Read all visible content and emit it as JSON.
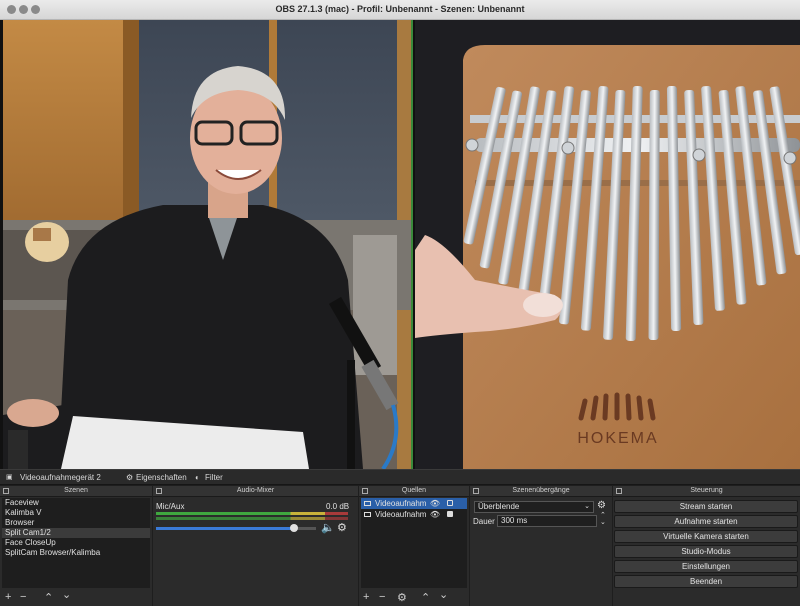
{
  "window": {
    "title": "OBS 27.1.3 (mac) - Profil: Unbenannt - Szenen: Unbenannt"
  },
  "preview": {
    "logo_text": "HOKEMA"
  },
  "sourcebar": {
    "source_name": "Videoaufnahmegerät 2",
    "properties_label": "Eigenschaften",
    "filter_label": "Filter"
  },
  "scenes": {
    "title": "Szenen",
    "items": [
      "Faceview",
      "Kalimba V",
      "Browser",
      "Split Cam1/2",
      "Face CloseUp",
      "SplitCam Browser/Kalimba"
    ],
    "selected_index": 3
  },
  "audio": {
    "title": "Audio-Mixer",
    "channel": "Mic/Aux",
    "level": "0.0 dB",
    "volume_fraction": 0.86
  },
  "sources": {
    "title": "Quellen",
    "items": [
      "Videoaufnahm",
      "Videoaufnahm"
    ]
  },
  "transitions": {
    "title": "Szenenübergänge",
    "selected": "Überblende",
    "duration_label": "Dauer",
    "duration_value": "300 ms"
  },
  "controls": {
    "title": "Steuerung",
    "stream": "Stream starten",
    "record": "Aufnahme starten",
    "virtual_cam": "Virtuelle Kamera starten",
    "studio": "Studio-Modus",
    "settings": "Einstellungen",
    "exit": "Beenden"
  },
  "colors": {
    "accent": "#2a5fa8",
    "meter_green": "#3fa83f",
    "meter_yellow": "#c8b23a"
  }
}
